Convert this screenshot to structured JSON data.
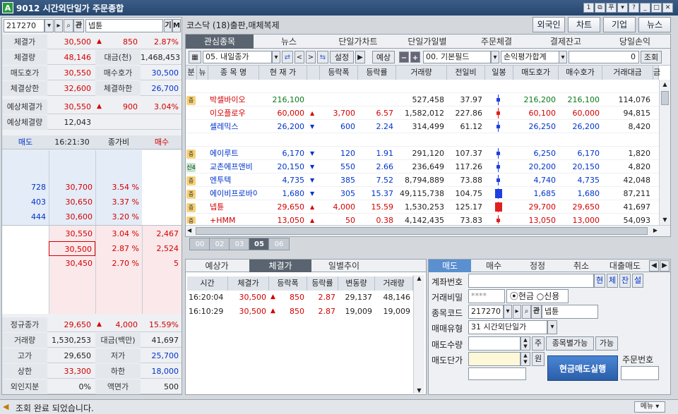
{
  "title": "9012  시간외단일가 주문종합",
  "titlebar_buttons": [
    "1",
    "⧉",
    "푸",
    "▾",
    "?",
    "_",
    "□",
    "✕"
  ],
  "left": {
    "code": "217270",
    "code_btn": "▾",
    "arrow_btn": "▸",
    "search_icon_label": "🔍",
    "yu_btn": "관",
    "name": "넵튠",
    "gi_btn": "기",
    "m_btn": "M",
    "summary": [
      {
        "l": "체결가",
        "v": "30,500",
        "c1": "▲",
        "c2": "850",
        "c3": "2.87%"
      },
      {
        "l": "체결량",
        "v": "48,146",
        "l2": "대금(천)",
        "v2": "1,468,453"
      },
      {
        "l": "매도호가",
        "v": "30,550",
        "l2": "매수호가",
        "v2": "30,500"
      },
      {
        "l": "체결상한",
        "v": "32,600",
        "l2": "체결하한",
        "v2": "26,700"
      }
    ],
    "expect": [
      {
        "l": "예상체결가",
        "v": "30,550",
        "c1": "▲",
        "c2": "900",
        "c3": "3.04%"
      },
      {
        "l": "예상체결량",
        "v": "12,043"
      }
    ],
    "ob_header": [
      "매도",
      "16:21:30",
      "종가비",
      "매수"
    ],
    "asks": [
      {
        "q": "728",
        "p": "30,700",
        "r": "3.54 %"
      },
      {
        "q": "403",
        "p": "30,650",
        "r": "3.37 %"
      },
      {
        "q": "444",
        "p": "30,600",
        "r": "3.20 %"
      }
    ],
    "bids": [
      {
        "p": "30,550",
        "r": "3.04 %",
        "q": "2,467"
      },
      {
        "p": "30,500",
        "r": "2.87 %",
        "q": "2,524"
      },
      {
        "p": "30,450",
        "r": "2.70 %",
        "q": "5"
      }
    ],
    "bottom": [
      {
        "l": "정규종가",
        "v": "29,650",
        "c1": "▲",
        "c2": "4,000",
        "c3": "15.59%"
      },
      {
        "l": "거래량",
        "v": "1,530,253",
        "l2": "대금(백만)",
        "v2": "41,697"
      },
      {
        "l": "고가",
        "v": "29,650",
        "l2": "저가",
        "v2": "25,700"
      },
      {
        "l": "상한",
        "v": "33,300",
        "l2": "하한",
        "v2": "18,000"
      },
      {
        "l": "외인지분",
        "v": "0%",
        "l2": "액면가",
        "v2": "500"
      }
    ]
  },
  "header": {
    "market": "코스닥  (18)출판,매체복제",
    "btns": [
      "외국인",
      "차트",
      "기업",
      "뉴스"
    ]
  },
  "tabs": [
    "관심종목",
    "뉴스",
    "단일가차트",
    "단일가일별",
    "주문체결",
    "결제잔고",
    "당일손익"
  ],
  "toolbar": {
    "group": "05. 내일종가",
    "set": "설정",
    "expect": "예상",
    "field": "00. 기본필드",
    "eval": "손익평가합계",
    "zero": "0",
    "query": "조회"
  },
  "grid_headers": [
    "분",
    "뉴",
    "종 목 명",
    "현 재 가",
    "",
    "등락폭",
    "등락률",
    "거래량",
    "전일비",
    "일봉",
    "매도호가",
    "매수호가",
    "거래대금",
    "금"
  ],
  "rows": [
    {
      "b": "",
      "name": "",
      "price": "",
      "ar": "",
      "chg": "",
      "rate": "",
      "vol": "",
      "prev": "",
      "ask": "",
      "bid": "",
      "amt": ""
    },
    {
      "b": "증",
      "name": "박셀바이오",
      "price": "216,100",
      "ar": "",
      "chg": "",
      "rate": "",
      "vol": "527,458",
      "prev": "37.97",
      "ask": "216,200",
      "bid": "216,100",
      "amt": "114,076",
      "c": "g"
    },
    {
      "b": "",
      "name": "이오플로우",
      "price": "60,000",
      "ar": "▲",
      "chg": "3,700",
      "rate": "6.57",
      "vol": "1,582,012",
      "prev": "227.86",
      "ask": "60,100",
      "bid": "60,000",
      "amt": "94,815",
      "c": "r"
    },
    {
      "b": "",
      "name": "셀레믹스",
      "price": "26,200",
      "ar": "▼",
      "chg": "600",
      "rate": "2.24",
      "vol": "314,499",
      "prev": "61.12",
      "ask": "26,250",
      "bid": "26,200",
      "amt": "8,420",
      "c": "b"
    },
    {
      "b": "",
      "name": "",
      "price": "",
      "ar": "",
      "chg": "",
      "rate": "",
      "vol": "",
      "prev": "",
      "ask": "",
      "bid": "",
      "amt": ""
    },
    {
      "b": "증",
      "name": "에이루트",
      "price": "6,170",
      "ar": "▼",
      "chg": "120",
      "rate": "1.91",
      "vol": "291,120",
      "prev": "107.37",
      "ask": "6,250",
      "bid": "6,170",
      "amt": "1,820",
      "c": "b"
    },
    {
      "b": "신4",
      "name": "교촌에프앤비",
      "price": "20,150",
      "ar": "▼",
      "chg": "550",
      "rate": "2.66",
      "vol": "236,649",
      "prev": "117.26",
      "ask": "20,200",
      "bid": "20,150",
      "amt": "4,820",
      "c": "b"
    },
    {
      "b": "증",
      "name": "엔투텍",
      "price": "4,735",
      "ar": "▼",
      "chg": "385",
      "rate": "7.52",
      "vol": "8,794,889",
      "prev": "73.88",
      "ask": "4,740",
      "bid": "4,735",
      "amt": "42,048",
      "c": "b"
    },
    {
      "b": "증",
      "name": "에이비프로바이오",
      "price": "1,680",
      "ar": "▼",
      "chg": "305",
      "rate": "15.37",
      "vol": "49,115,738",
      "prev": "104.75",
      "ask": "1,685",
      "bid": "1,680",
      "amt": "87,211",
      "c": "b"
    },
    {
      "b": "증",
      "name": "넵튠",
      "price": "29,650",
      "ar": "▲",
      "chg": "4,000",
      "rate": "15.59",
      "vol": "1,530,253",
      "prev": "125.17",
      "ask": "29,700",
      "bid": "29,650",
      "amt": "41,697",
      "c": "r"
    },
    {
      "b": "증",
      "name": "+HMM",
      "price": "13,050",
      "ar": "▲",
      "chg": "50",
      "rate": "0.38",
      "vol": "4,142,435",
      "prev": "73.83",
      "ask": "13,050",
      "bid": "13,000",
      "amt": "54,093",
      "c": "r"
    }
  ],
  "page_tabs": [
    "00",
    "02",
    "03",
    "05",
    "06"
  ],
  "mid": {
    "tabs": [
      "예상가",
      "체결가",
      "일별추이"
    ],
    "headers": [
      "시간",
      "체결가",
      "등락폭",
      "등락률",
      "변동량",
      "거래량"
    ],
    "rows": [
      {
        "t": "16:20:04",
        "p": "30,500",
        "a": "▲",
        "c": "850",
        "r": "2.87",
        "d": "29,137",
        "v": "48,146"
      },
      {
        "t": "16:10:29",
        "p": "30,500",
        "a": "▲",
        "c": "850",
        "r": "2.87",
        "d": "19,009",
        "v": "19,009"
      }
    ]
  },
  "order": {
    "tabs": [
      "매도",
      "매수",
      "정정",
      "취소",
      "대출매도"
    ],
    "acct_label": "계좌번호",
    "acct_btns": [
      "현",
      "체",
      "잔",
      "설"
    ],
    "pw_label": "거래비밀",
    "pw": "****",
    "cash": "현금",
    "credit": "신용",
    "code_label": "종목코드",
    "code": "217270",
    "name": "넵튠",
    "yu": "관",
    "type_label": "매매유형",
    "type": "31 시간외단일가",
    "qty_label": "매도수량",
    "qty_btn": "주",
    "qty_btn2": "종목별가능",
    "qty_btn3": "가능",
    "price_label": "매도단가",
    "price_btn": "원",
    "exec": "현금매도실행",
    "order_no": "주문번호"
  },
  "status": {
    "msg": "조회 완료 되었습니다.",
    "menu": "메뉴 ▾"
  }
}
